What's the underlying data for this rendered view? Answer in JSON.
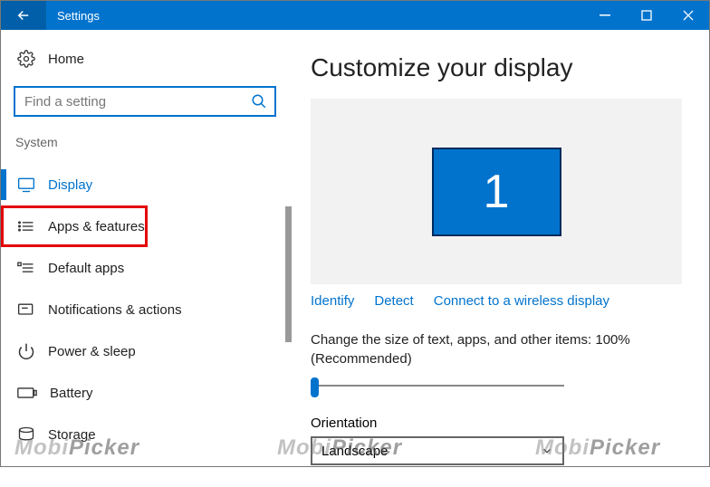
{
  "titlebar": {
    "title": "Settings"
  },
  "sidebar": {
    "home": "Home",
    "search_placeholder": "Find a setting",
    "group": "System",
    "items": [
      {
        "label": "Display"
      },
      {
        "label": "Apps & features"
      },
      {
        "label": "Default apps"
      },
      {
        "label": "Notifications & actions"
      },
      {
        "label": "Power & sleep"
      },
      {
        "label": "Battery"
      },
      {
        "label": "Storage"
      }
    ]
  },
  "main": {
    "heading": "Customize your display",
    "monitor_number": "1",
    "links": {
      "identify": "Identify",
      "detect": "Detect",
      "wireless": "Connect to a wireless display"
    },
    "scale_text": "Change the size of text, apps, and other items: 100% (Recommended)",
    "orientation_label": "Orientation",
    "orientation_value": "Landscape"
  },
  "watermark": {
    "a": "Mobi",
    "b": "Picker"
  }
}
